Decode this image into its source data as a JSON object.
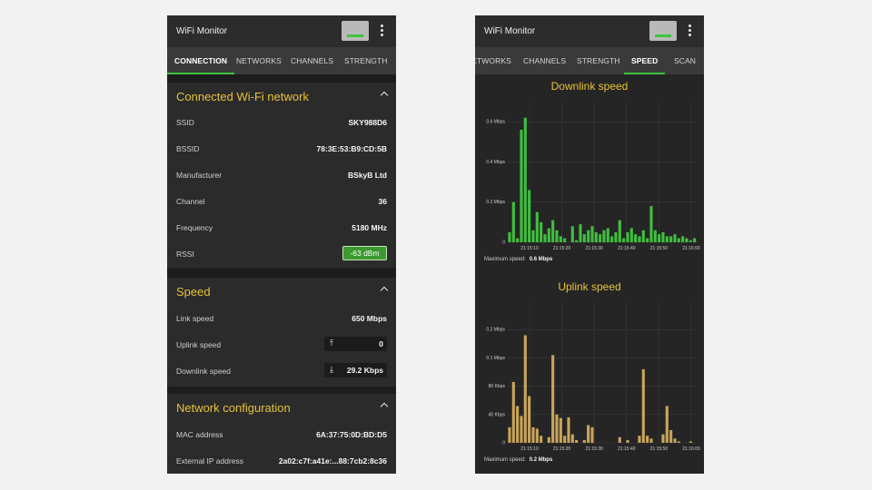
{
  "left": {
    "app_title": "WiFi Monitor",
    "tabs": [
      "CONNECTION",
      "NETWORKS",
      "CHANNELS",
      "STRENGTH"
    ],
    "active_tab": "CONNECTION",
    "sections": {
      "connected": {
        "title": "Connected Wi-Fi network",
        "rows": [
          {
            "label": "SSID",
            "value": "SKY988D6"
          },
          {
            "label": "BSSID",
            "value": "78:3E:53:B9:CD:5B"
          },
          {
            "label": "Manufacturer",
            "value": "BSkyB Ltd"
          },
          {
            "label": "Channel",
            "value": "36"
          },
          {
            "label": "Frequency",
            "value": "5180 MHz"
          },
          {
            "label": "RSSI",
            "value": "-63 dBm"
          }
        ]
      },
      "speed": {
        "title": "Speed",
        "rows": [
          {
            "label": "Link speed",
            "value": "650 Mbps"
          },
          {
            "label": "Uplink speed",
            "value": "0"
          },
          {
            "label": "Downlink speed",
            "value": "29.2 Kbps"
          }
        ]
      },
      "netconfig": {
        "title": "Network configuration",
        "rows": [
          {
            "label": "MAC address",
            "value": "6A:37:75:0D:BD:D5"
          },
          {
            "label": "External IP address",
            "value": "2a02:c7f:a41e:...88:7cb2:8c36"
          }
        ]
      }
    }
  },
  "right": {
    "app_title": "WiFi Monitor",
    "tabs": [
      "NETWORKS",
      "CHANNELS",
      "STRENGTH",
      "SPEED",
      "SCAN"
    ],
    "active_tab": "SPEED",
    "downlink": {
      "title": "Downlink speed",
      "max_label": "Maximum speed:",
      "max_value": "0.6 Mbps"
    },
    "uplink": {
      "title": "Uplink speed",
      "max_label": "Maximum speed:",
      "max_value": "0.2 Mbps"
    }
  },
  "colors": {
    "accent_yellow": "#e7c23a",
    "accent_green": "#3ec43e",
    "downlink_bar": "#3fbf3f",
    "uplink_bar": "#c9a45a",
    "panel_bg": "#2b2b2b",
    "page_bg": "#f2f2f2"
  },
  "icons": {
    "signal": "signal-strength-icon",
    "menu": "more-vert-icon",
    "collapse": "chevron-up-icon",
    "upload": "upload-icon",
    "download": "download-icon"
  },
  "chart_data": [
    {
      "type": "bar",
      "title": "Downlink speed",
      "xlabel": "",
      "ylabel": "",
      "y_unit": "Mbps",
      "ylim": [
        0,
        0.7
      ],
      "yticks": [
        "0",
        "0.2 Mbps",
        "0.4 Mbps",
        "0.6 Mbps"
      ],
      "ytick_values": [
        0,
        0.2,
        0.4,
        0.6
      ],
      "xticks": [
        "21:15:10",
        "21:15:20",
        "21:15:30",
        "21:15:40",
        "21:15:50",
        "21:16:00"
      ],
      "grid": true,
      "values": [
        0.05,
        0.2,
        0.02,
        0.56,
        0.62,
        0.26,
        0.06,
        0.15,
        0.1,
        0.04,
        0.07,
        0.11,
        0.06,
        0.03,
        0.02,
        0.0,
        0.08,
        0.01,
        0.09,
        0.04,
        0.06,
        0.08,
        0.05,
        0.04,
        0.06,
        0.07,
        0.03,
        0.05,
        0.11,
        0.02,
        0.05,
        0.07,
        0.04,
        0.03,
        0.06,
        0.02,
        0.18,
        0.06,
        0.04,
        0.05,
        0.03,
        0.03,
        0.04,
        0.02,
        0.03,
        0.02,
        0.01,
        0.02
      ]
    },
    {
      "type": "bar",
      "title": "Uplink speed",
      "xlabel": "",
      "ylabel": "",
      "y_unit": "Kbps",
      "ylim": [
        0,
        200
      ],
      "yticks": [
        "0",
        "40 Kbps",
        "80 Kbps",
        "0.1 Mbps",
        "0.2 Mbps"
      ],
      "ytick_values": [
        0,
        40,
        80,
        120,
        160
      ],
      "xticks": [
        "21:15:10",
        "21:15:20",
        "21:15:30",
        "21:15:40",
        "21:15:50",
        "21:16:00"
      ],
      "grid": true,
      "values": [
        22,
        86,
        52,
        38,
        152,
        66,
        22,
        20,
        10,
        0,
        8,
        124,
        40,
        35,
        10,
        36,
        12,
        4,
        0,
        4,
        25,
        22,
        0,
        0,
        0,
        0,
        0,
        0,
        8,
        0,
        4,
        0,
        0,
        10,
        104,
        10,
        6,
        0,
        0,
        12,
        52,
        18,
        6,
        2,
        0,
        0,
        2,
        0
      ]
    }
  ]
}
